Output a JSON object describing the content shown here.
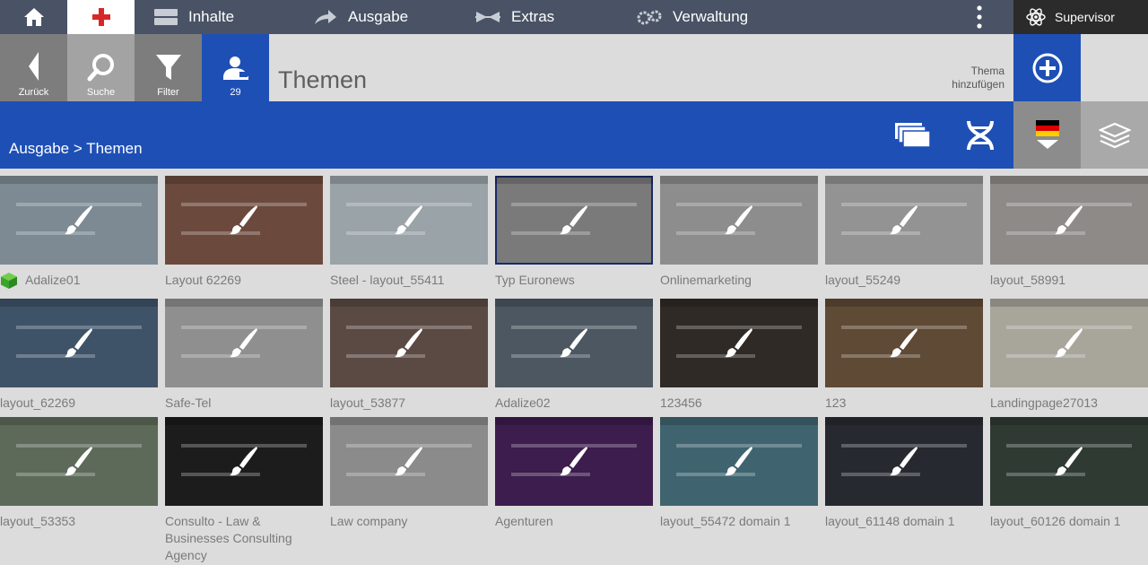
{
  "nav": {
    "items": [
      {
        "label": "Inhalte",
        "icon": "content-icon"
      },
      {
        "label": "Ausgabe",
        "icon": "output-arrow-icon"
      },
      {
        "label": "Extras",
        "icon": "extras-icon"
      },
      {
        "label": "Verwaltung",
        "icon": "gears-icon"
      }
    ],
    "user": "Supervisor"
  },
  "toolbar": {
    "back_label": "Zurück",
    "search_label": "Suche",
    "filter_label": "Filter",
    "count": "29",
    "page_title": "Themen",
    "add_label": "Thema hinzufügen"
  },
  "breadcrumb": "Ausgabe > Themen",
  "colors": {
    "nav_bg": "#495365",
    "accent_blue": "#1e4fb5",
    "tool_gray": "#7d7d7d",
    "page_bg": "#dcdcdc"
  },
  "themes": [
    {
      "name": "Adalize01",
      "active": true,
      "thumb": "#7d8a93"
    },
    {
      "name": "Layout 62269",
      "active": false,
      "thumb": "#6b4a3d"
    },
    {
      "name": "Steel - layout_55411",
      "active": false,
      "thumb": "#9aa3a8"
    },
    {
      "name": "Typ Euronews",
      "active": false,
      "thumb": "#7a7a7a",
      "selected": true
    },
    {
      "name": "Onlinemarketing",
      "active": false,
      "thumb": "#8d8d8d"
    },
    {
      "name": "layout_55249",
      "active": false,
      "thumb": "#939393"
    },
    {
      "name": "layout_58991",
      "active": false,
      "thumb": "#8e8a88"
    },
    {
      "name": "layout_62269",
      "active": false,
      "thumb": "#3e5368"
    },
    {
      "name": "Safe-Tel",
      "active": false,
      "thumb": "#8f8f8f"
    },
    {
      "name": "layout_53877",
      "active": false,
      "thumb": "#5b4a44"
    },
    {
      "name": "Adalize02",
      "active": false,
      "thumb": "#4c5761"
    },
    {
      "name": "123456",
      "active": false,
      "thumb": "#2f2a26"
    },
    {
      "name": "123",
      "active": false,
      "thumb": "#5e4a35"
    },
    {
      "name": "Landingpage27013",
      "active": false,
      "thumb": "#a8a59b"
    },
    {
      "name": "layout_53353",
      "active": false,
      "thumb": "#5d6a5a"
    },
    {
      "name": "Consulto - Law & Businesses Consulting Agency",
      "active": false,
      "thumb": "#1c1c1c"
    },
    {
      "name": "Law company",
      "active": false,
      "thumb": "#8b8b8b"
    },
    {
      "name": "Agenturen",
      "active": false,
      "thumb": "#3c1d4e"
    },
    {
      "name": "layout_55472 domain 1",
      "active": false,
      "thumb": "#3f6470"
    },
    {
      "name": "layout_61148 domain 1",
      "active": false,
      "thumb": "#262a30"
    },
    {
      "name": "layout_60126 domain 1",
      "active": false,
      "thumb": "#2f3a33"
    }
  ]
}
